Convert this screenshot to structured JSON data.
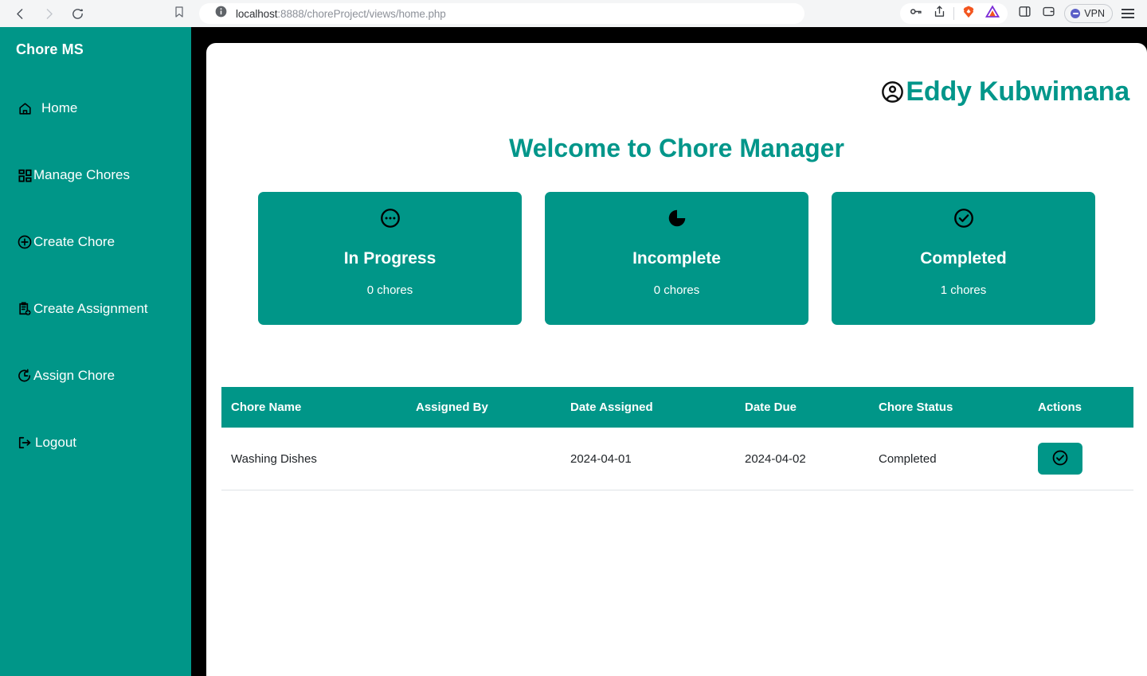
{
  "browser": {
    "back_icon": "chevron-left-icon",
    "forward_icon": "chevron-right-icon",
    "reload_icon": "reload-icon",
    "bookmark_icon": "bookmark-icon",
    "site_info_icon": "info-circle-icon",
    "url_host": "localhost",
    "url_path": ":8888/choreProject/views/home.php",
    "url_full": "localhost:8888/choreProject/views/home.php",
    "password_icon": "key-icon",
    "share_icon": "share-icon",
    "brave_shields_icon": "brave-lion-icon",
    "brave_rewards_icon": "brave-triangle-icon",
    "sidebar_panel_icon": "side-panel-icon",
    "wallet_icon": "wallet-icon",
    "vpn_label": "VPN",
    "menu_icon": "hamburger-menu-icon"
  },
  "sidebar": {
    "brand": "Chore MS",
    "items": [
      {
        "label": "Home",
        "icon": "home-icon"
      },
      {
        "label": "Manage Chores",
        "icon": "grid-icon"
      },
      {
        "label": "Create Chore",
        "icon": "plus-circle-icon"
      },
      {
        "label": "Create Assignment",
        "icon": "clipboard-plus-icon"
      },
      {
        "label": "Assign Chore",
        "icon": "clock-arrow-icon"
      },
      {
        "label": "Logout",
        "icon": "logout-icon"
      }
    ]
  },
  "header": {
    "user_icon": "user-circle-icon",
    "user_name": "Eddy Kubwimana"
  },
  "main": {
    "welcome_title": "Welcome to Chore Manager",
    "cards": [
      {
        "title": "In Progress",
        "count": "0 chores",
        "icon": "ellipsis-circle-icon"
      },
      {
        "title": "Incomplete",
        "count": "0 chores",
        "icon": "pie-chart-icon"
      },
      {
        "title": "Completed",
        "count": "1 chores",
        "icon": "check-circle-icon"
      }
    ]
  },
  "table": {
    "headers": [
      "Chore Name",
      "Assigned By",
      "Date Assigned",
      "Date Due",
      "Chore Status",
      "Actions"
    ],
    "rows": [
      {
        "chore_name": "Washing Dishes",
        "assigned_by": "",
        "date_assigned": "2024-04-01",
        "date_due": "2024-04-02",
        "chore_status": "Completed",
        "action_icon": "check-circle-icon"
      }
    ]
  },
  "colors": {
    "brand_teal": "#009688",
    "heading_teal": "#00968a",
    "sidebar_teal": "#009688",
    "page_background": "#000000"
  }
}
